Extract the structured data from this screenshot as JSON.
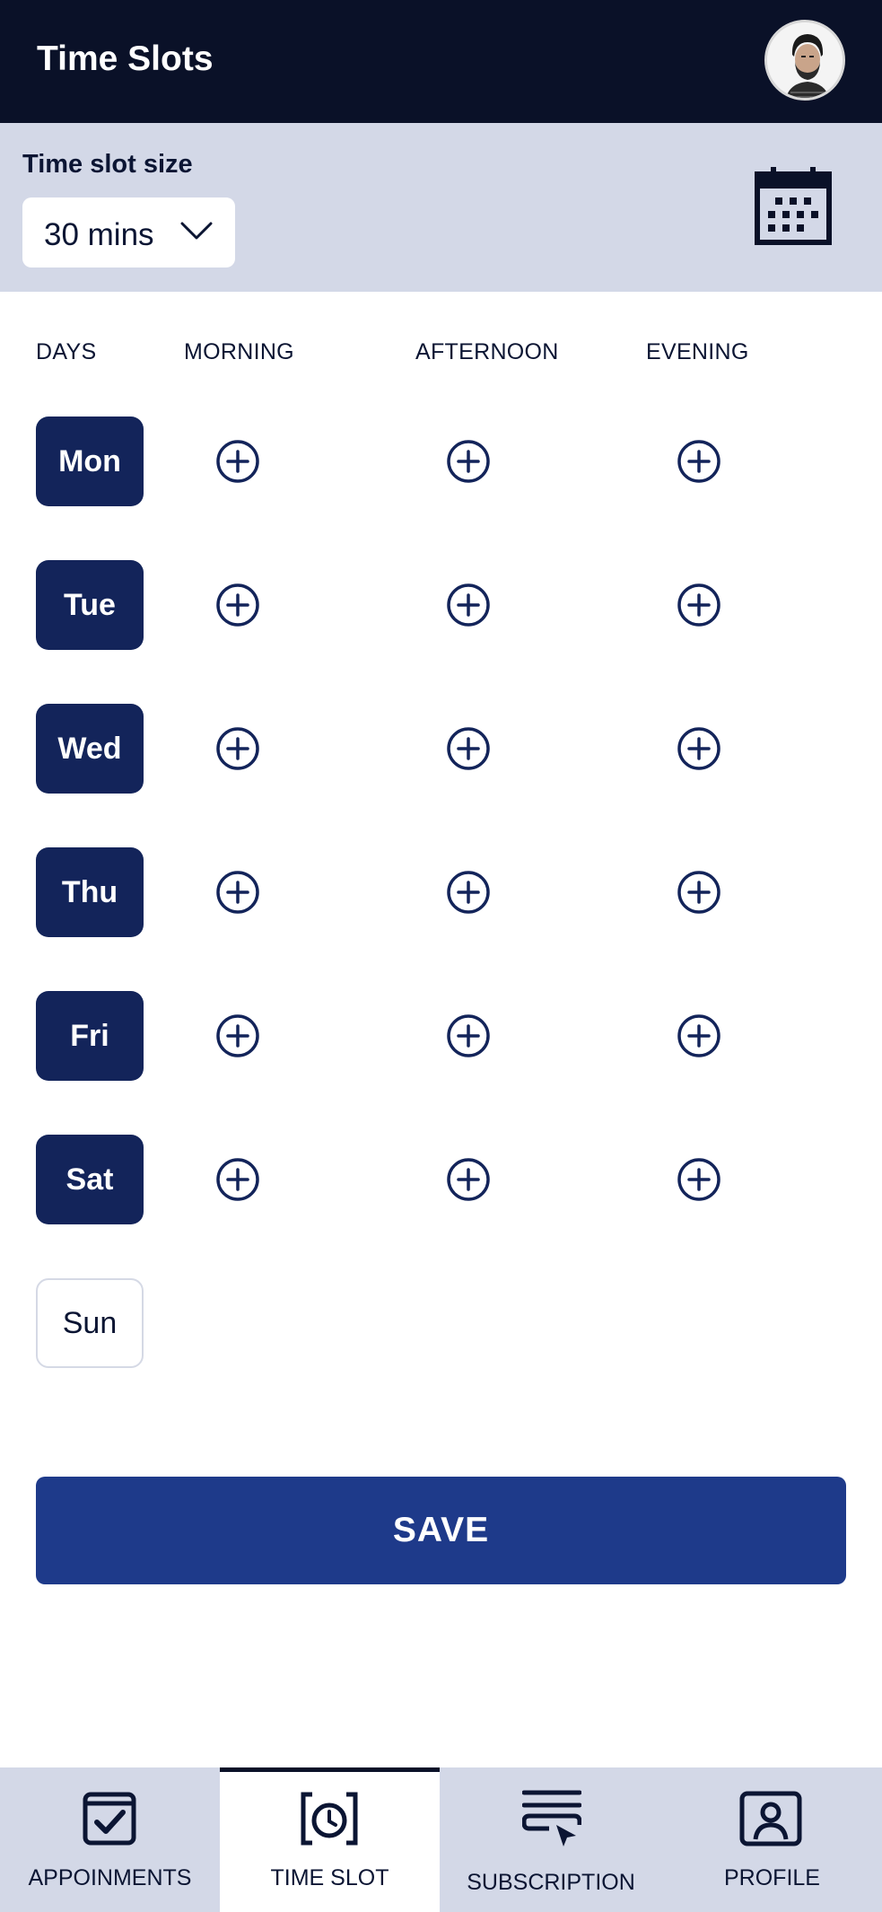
{
  "header": {
    "title": "Time Slots",
    "avatar_icon": "user-avatar"
  },
  "settings": {
    "slot_size_label": "Time slot size",
    "slot_size_value": "30 mins",
    "calendar_icon": "calendar-icon"
  },
  "columns": [
    "DAYS",
    "MORNING",
    "AFTERNOON",
    "EVENING"
  ],
  "days": [
    {
      "label": "Mon",
      "enabled": true
    },
    {
      "label": "Tue",
      "enabled": true
    },
    {
      "label": "Wed",
      "enabled": true
    },
    {
      "label": "Thu",
      "enabled": true
    },
    {
      "label": "Fri",
      "enabled": true
    },
    {
      "label": "Sat",
      "enabled": true
    },
    {
      "label": "Sun",
      "enabled": false
    }
  ],
  "save_label": "SAVE",
  "nav": [
    {
      "label": "APPOINMENTS",
      "icon": "appointments-icon",
      "active": false
    },
    {
      "label": "TIME SLOT",
      "icon": "time-slot-icon",
      "active": true
    },
    {
      "label": "SUBSCRIPTION",
      "icon": "subscription-icon",
      "active": false
    },
    {
      "label": "PROFILE",
      "icon": "profile-icon",
      "active": false
    }
  ],
  "colors": {
    "dark": "#0a1128",
    "navy": "#13245a",
    "accent": "#1e3a8a",
    "panel": "#d3d8e7"
  }
}
